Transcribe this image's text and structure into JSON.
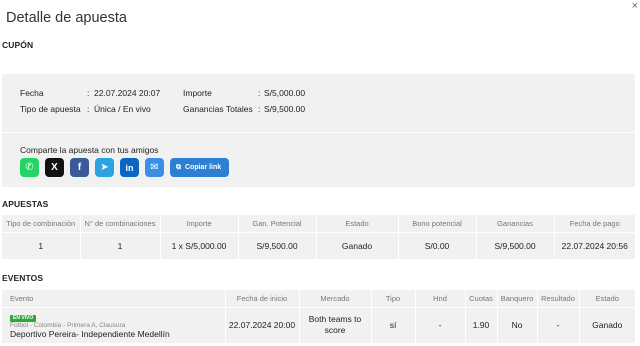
{
  "modal": {
    "title": "Detalle de apuesta",
    "close_glyph": "×"
  },
  "coupon": {
    "section_label": "CUPÓN",
    "fecha_label": "Fecha",
    "fecha_value": "22.07.2024 20:07",
    "tipo_label": "Tipo de apuesta",
    "tipo_value": "Única / En vivo",
    "importe_label": "Importe",
    "importe_value": "S/5,000.00",
    "ganancias_label": "Ganancias Totales",
    "ganancias_value": "S/9,500.00",
    "colon": ":",
    "share_text": "Comparte la apuesta con tus amigos",
    "share_icons": [
      {
        "name": "whatsapp-icon",
        "glyph": "✆",
        "color": "#25d366"
      },
      {
        "name": "x-twitter-icon",
        "glyph": "X",
        "color": "#111111"
      },
      {
        "name": "facebook-icon",
        "glyph": "f",
        "color": "#3b5998"
      },
      {
        "name": "telegram-icon",
        "glyph": "➤",
        "color": "#2aa3e0"
      },
      {
        "name": "linkedin-icon",
        "glyph": "in",
        "color": "#0a66c2"
      },
      {
        "name": "email-icon",
        "glyph": "✉",
        "color": "#3a8ee6"
      }
    ],
    "copy_label": "Copiar link",
    "copy_glyph": "⧉",
    "copy_color": "#2d7fd3"
  },
  "apuestas": {
    "section_label": "APUESTAS",
    "headers": [
      "Tipo de combinación",
      "N° de combinaciones",
      "Importe",
      "Gan. Potencial",
      "Estado",
      "Bono potencial",
      "Ganancias",
      "Fecha de pago"
    ],
    "row": [
      "1",
      "1",
      "1 x S/5,000.00",
      "S/9,500.00",
      "Ganado",
      "S/0.00",
      "S/9,500.00",
      "22.07.2024 20:56"
    ]
  },
  "eventos": {
    "section_label": "EVENTOS",
    "headers": [
      "Evento",
      "Fecha de inicio",
      "Mercado",
      "Tipo",
      "Hnd",
      "Cuotas",
      "Banquero",
      "Resultado",
      "Estado"
    ],
    "live_badge": "EN VIVO",
    "league": "Fútbol - Colombia - Primera A, Clausura",
    "match": "Deportivo Pereira- Independiente Medellín",
    "fecha_inicio": "22.07.2024 20:00",
    "mercado": "Both teams to score",
    "tipo": "sí",
    "hnd": "-",
    "cuotas": "1.90",
    "banquero": "No",
    "resultado": "-",
    "estado": "Ganado"
  },
  "colors": {
    "won": "#2ea83c",
    "panel": "#f1f1f1"
  }
}
